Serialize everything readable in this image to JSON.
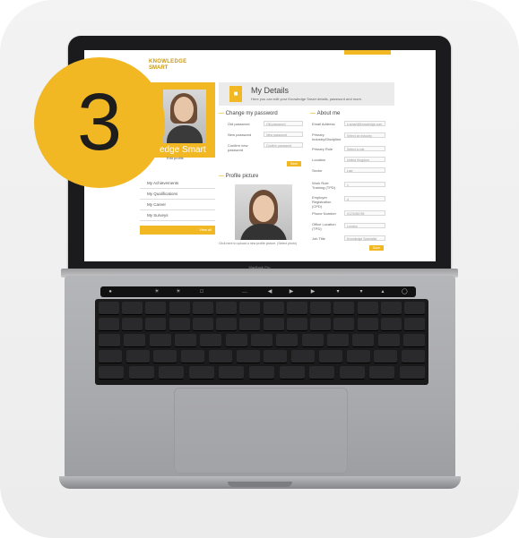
{
  "badge": {
    "number": "3"
  },
  "app": {
    "logo_line1": "KNOWLEDGE",
    "logo_line2": "SMART",
    "profile_name": "edge Smart",
    "profile_link": "Edit profile",
    "menu": [
      {
        "label": "My Achievements"
      },
      {
        "label": "My Qualifications"
      },
      {
        "label": "My Career"
      },
      {
        "label": "My Surveys"
      }
    ],
    "menu_button": "View all"
  },
  "details": {
    "title": "My Details",
    "subtitle": "Here you can edit your Knowledge Smart details, password and more.",
    "icon": "user-card-icon"
  },
  "password": {
    "title": "Change my password",
    "fields": [
      {
        "label": "Old password",
        "placeholder": "Old password"
      },
      {
        "label": "New password",
        "placeholder": "New password"
      },
      {
        "label": "Confirm new password",
        "placeholder": "Confirm password"
      }
    ],
    "save": "Save"
  },
  "profile_picture": {
    "title": "Profile picture",
    "caption": "Click here to upload a new profile picture. (Select photo)"
  },
  "about": {
    "title": "About me",
    "fields": [
      {
        "label": "Email Address",
        "value": "k.smart@knowledge.com"
      },
      {
        "label": "Primary Industry/Discipline",
        "value": "Select an industry"
      },
      {
        "label": "Primary Role",
        "value": "Select a role"
      },
      {
        "label": "Location",
        "value": "United Kingdom"
      },
      {
        "label": "Sector",
        "value": "Law"
      },
      {
        "label": "Work Role Training (TPD)",
        "value": "1"
      },
      {
        "label": "Employer Registration (CPD)",
        "value": "4"
      },
      {
        "label": "Phone Number",
        "value": "0123456789"
      },
      {
        "label": "Office Location (TPD)",
        "value": "London"
      },
      {
        "label": "Job Title",
        "value": "Knowledge Specialist"
      }
    ],
    "save": "Save"
  },
  "laptop": {
    "model_label": "MacBook Pro"
  },
  "colors": {
    "accent": "#f2b824",
    "badge_text": "#1d1d1d"
  }
}
